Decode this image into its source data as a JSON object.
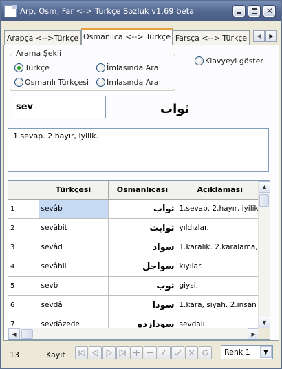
{
  "window": {
    "title": "Arp, Osm, Far <-> Türkçe Sozlük v1.69 beta"
  },
  "tabs": [
    {
      "label": "Arapça <-->Türkçe"
    },
    {
      "label": "Osmanlıca <--> Türkçe"
    },
    {
      "label": "Farsça <--> Türkçe"
    }
  ],
  "search_mode": {
    "legend": "Arama Şekli",
    "options": [
      {
        "label": "Türkçe",
        "checked": true
      },
      {
        "label": "İmlasında Ara",
        "checked": false
      },
      {
        "label": "Osmanlı Türkçesi",
        "checked": false
      },
      {
        "label": "İmlasında Ara",
        "checked": false
      }
    ]
  },
  "keyboard_option": {
    "label": "Klavyeyi göster",
    "checked": false
  },
  "search": {
    "value": "sev",
    "arabic": "ثواب"
  },
  "meaning": "1.sevap. 2.hayır, iyilik.",
  "grid": {
    "columns": [
      "Türkçesi",
      "Osmanlıcası",
      "Açıklaması"
    ],
    "rows": [
      {
        "num": "1",
        "turkish": "sevâb",
        "ottoman": "ثواب",
        "desc": "1.sevap. 2.hayır, iyilik."
      },
      {
        "num": "2",
        "turkish": "sevâbit",
        "ottoman": "ثوابت",
        "desc": "yıldızlar."
      },
      {
        "num": "3",
        "turkish": "sevâd",
        "ottoman": "سواد",
        "desc": "1.karalık. 2.karalama,"
      },
      {
        "num": "4",
        "turkish": "sevâhil",
        "ottoman": "سواحل",
        "desc": "kıyılar."
      },
      {
        "num": "5",
        "turkish": "sevb",
        "ottoman": "ثوب",
        "desc": "giysi."
      },
      {
        "num": "6",
        "turkish": "sevdâ",
        "ottoman": "سودا",
        "desc": "1.kara, siyah. 2.insan"
      },
      {
        "num": "7",
        "turkish": "sevdâzede",
        "ottoman": "سودازده",
        "desc": "sevdalı."
      }
    ]
  },
  "footer": {
    "count": "13",
    "record_label": "Kayıt",
    "color_select": "Renk 1"
  }
}
